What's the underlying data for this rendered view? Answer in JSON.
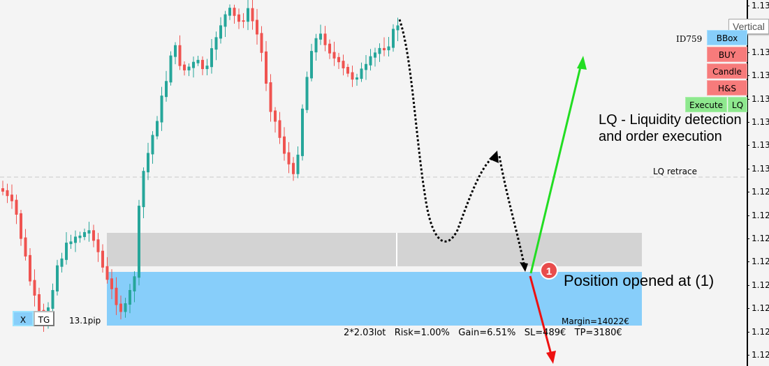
{
  "price_axis": {
    "labels": [
      "1.13",
      "1.13",
      "1.13",
      "1.13",
      "1.13",
      "1.13",
      "1.13",
      "1.13",
      "1.12",
      "1.12",
      "1.12",
      "1.12",
      "1.12",
      "1.12",
      "1.12",
      "1.12"
    ]
  },
  "tooltip": "Vertical",
  "panel": {
    "id_label": "ID759",
    "bbox": "BBox",
    "buy": "BUY",
    "candle": "Candle",
    "hs": "H&S",
    "execute": "Execute",
    "lq": "LQ"
  },
  "annotation": {
    "line1": "LQ - Liquidity detection",
    "line2": "and order execution",
    "retrace": "LQ retrace",
    "badge": "1",
    "position": "Position opened at (1)"
  },
  "trade": {
    "margin": "Margin=14022€",
    "summary": "2*2.03lot   Risk=1.00%   Gain=6.51%   SL=489€   TP=3180€",
    "pips": "13.1pip"
  },
  "left_buttons": {
    "x": "X",
    "tg": "TG"
  },
  "colors": {
    "bull": "#26a69a",
    "bear": "#ef5350",
    "zone_blue": "#87cefa",
    "zone_gray": "#d3d3d3",
    "tp_arrow": "#22dd22",
    "sl_arrow": "#ee1111"
  }
}
